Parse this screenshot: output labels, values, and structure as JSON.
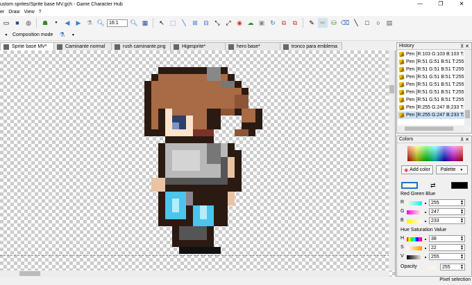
{
  "window": {
    "title": "ustom sprites/Sprite base MV.gch - Game Character Hub",
    "minimize": "—",
    "maximize": "❐",
    "close": "✕"
  },
  "menu": [
    "er",
    "Draw",
    "View",
    "?"
  ],
  "toolbar": {
    "zoom_value": "16:1"
  },
  "toolbar2": {
    "composition_label": "Composition mode"
  },
  "tabs": [
    {
      "label": "Sprite base MV*",
      "active": true
    },
    {
      "label": "Caminante normal",
      "active": false
    },
    {
      "label": "rush caminante.png",
      "active": false
    },
    {
      "label": "Higesprite*",
      "active": false
    },
    {
      "label": "hero base*",
      "active": false
    },
    {
      "label": "tronco para emblema",
      "active": false
    }
  ],
  "history": {
    "title": "History",
    "items": [
      "Pen [R:103 G:103 B:103 T:",
      "Pen [R:51 G:51 B:51 T:255",
      "Pen [R:51 G:51 B:51 T:255",
      "Pen [R:51 G:51 B:51 T:255",
      "Pen [R:51 G:51 B:51 T:255",
      "Pen [R:51 G:51 B:51 T:255",
      "Pen [R:51 G:51 B:51 T:255",
      "Pen [R:255 G:247 B:233 T:",
      "Pen [R:255 G:247 B:233 T:"
    ],
    "selected_index": 8
  },
  "colors": {
    "title": "Colors",
    "add_color": "Add color",
    "palette": "Palette",
    "rgb_label": "Red Green Blue",
    "r_label": "R",
    "g_label": "G",
    "b_label": "B",
    "r": "255",
    "g": "247",
    "b": "233",
    "hsv_label": "Hue Saturation Value",
    "h_label": "H",
    "s_label": "S",
    "v_label": "V",
    "h": "38",
    "s": "22",
    "v": "255",
    "opacity_label": "Opacity",
    "opacity": "255",
    "fg_color": "#fff7e9",
    "bg_color": "#000000"
  },
  "status": {
    "text": "Pixel selection"
  }
}
